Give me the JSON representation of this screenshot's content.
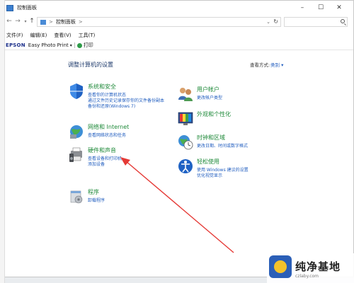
{
  "window": {
    "title": "控制面板"
  },
  "nav": {
    "address": "控制面板",
    "address_sep": ">",
    "search_placeholder": ""
  },
  "menu": {
    "items": [
      "文件(F)",
      "编辑(E)",
      "查看(V)",
      "工具(T)"
    ]
  },
  "toolbar": {
    "brand": "EPSON",
    "app": "Easy Photo Print",
    "print": "打印"
  },
  "main": {
    "title": "调整计算机的设置",
    "view_by_label": "查看方式:",
    "view_by_value": "类别",
    "categories": [
      {
        "title": "系统和安全",
        "links": [
          "查看你的计算机状态",
          "通过文件历史记录保存你的文件备份副本",
          "备份和还原(Windows 7)"
        ],
        "icon": "shield-icon"
      },
      {
        "title": "网络和 Internet",
        "links": [
          "查看网络状态和任务"
        ],
        "icon": "network-globe-icon"
      },
      {
        "title": "硬件和声音",
        "links": [
          "查看设备和打印机",
          "添加设备"
        ],
        "icon": "printer-speaker-icon"
      },
      {
        "title": "程序",
        "links": [
          "卸载程序"
        ],
        "icon": "programs-icon"
      },
      {
        "title": "用户帐户",
        "links": [
          "更改帐户类型"
        ],
        "icon": "users-icon"
      },
      {
        "title": "外观和个性化",
        "links": [],
        "icon": "appearance-icon"
      },
      {
        "title": "时钟和区域",
        "links": [
          "更改日期、时间或数字格式"
        ],
        "icon": "clock-globe-icon"
      },
      {
        "title": "轻松使用",
        "links": [
          "使用 Windows 建议的设置",
          "优化视觉显示"
        ],
        "icon": "accessibility-icon"
      }
    ]
  },
  "annotation": {
    "color": "#e53935"
  },
  "watermark": {
    "text": "纯净基地",
    "sub": "czlaby.com"
  }
}
